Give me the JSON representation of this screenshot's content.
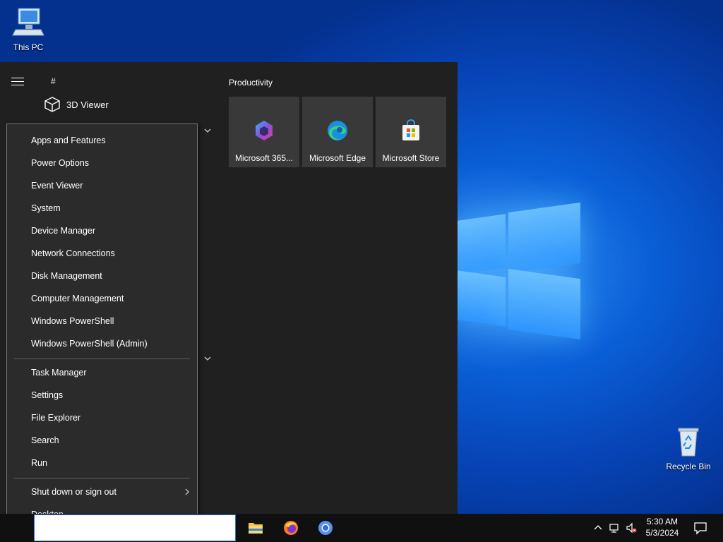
{
  "desktop": {
    "icons": [
      {
        "label": "This PC"
      },
      {
        "label": "Recycle Bin"
      }
    ]
  },
  "start_menu": {
    "list_header": "#",
    "apps": [
      {
        "label": "3D Viewer"
      }
    ],
    "tiles_group": "Productivity",
    "tiles": [
      {
        "label": "Microsoft 365...",
        "icon": "microsoft-365-icon"
      },
      {
        "label": "Microsoft Edge",
        "icon": "edge-icon"
      },
      {
        "label": "Microsoft Store",
        "icon": "store-icon"
      }
    ]
  },
  "power_menu": {
    "group1": [
      "Apps and Features",
      "Power Options",
      "Event Viewer",
      "System",
      "Device Manager",
      "Network Connections",
      "Disk Management",
      "Computer Management",
      "Windows PowerShell",
      "Windows PowerShell (Admin)"
    ],
    "group2": [
      "Task Manager",
      "Settings",
      "File Explorer",
      "Search",
      "Run"
    ],
    "group3": [
      "Shut down or sign out",
      "Desktop"
    ]
  },
  "taskbar": {
    "apps": [
      "file-explorer-icon",
      "firefox-icon",
      "chromium-icon"
    ],
    "clock": {
      "time": "5:30 AM",
      "date": "5/3/2024"
    }
  },
  "colors": {
    "start_bg": "#202020",
    "menu_bg": "#2b2b2b",
    "tile_bg": "#393939",
    "accent": "#0a5fd6"
  }
}
